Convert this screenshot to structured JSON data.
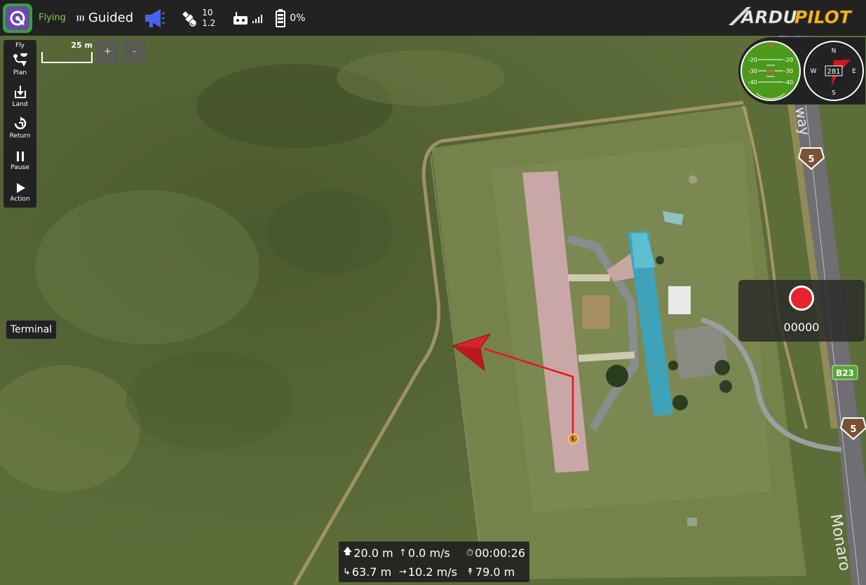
{
  "toolbar": {
    "flight_status": "Flying",
    "flight_mode": "Guided",
    "gps_satellites": "10",
    "gps_hdop": "1.2",
    "battery_percent": "0%",
    "brand_logo": "ARDUPILOT"
  },
  "fly_tools": {
    "title": "Fly",
    "items": [
      {
        "label": "Plan",
        "icon": "plan-icon"
      },
      {
        "label": "Land",
        "icon": "land-icon"
      },
      {
        "label": "Return",
        "icon": "return-icon"
      },
      {
        "label": "Pause",
        "icon": "pause-icon"
      },
      {
        "label": "Action",
        "icon": "action-icon"
      }
    ]
  },
  "map": {
    "scale_label": "25 m",
    "zoom_in_label": "+",
    "zoom_out_label": "-",
    "road_labels": [
      "5",
      "B23",
      "5"
    ],
    "road_name_fragment": "Monaro",
    "road_name_fragment2": "way",
    "home_marker_label": "L"
  },
  "terminal": {
    "label": "Terminal"
  },
  "instruments": {
    "pitch_labels": [
      "-20",
      "-20",
      "-30",
      "-30",
      "-40",
      "-40"
    ],
    "compass": {
      "heading": "281",
      "north": "N",
      "south": "S",
      "east": "E",
      "west": "W"
    }
  },
  "video": {
    "record_time": "00000"
  },
  "telemetry": {
    "altitude": "20.0 m",
    "vertical_speed": "0.0 m/s",
    "flight_time": "00:00:26",
    "distance_home": "63.7 m",
    "ground_speed": "10.2 m/s",
    "altitude_amsl": "79.0 m"
  },
  "colors": {
    "toolbar_bg": "#222222",
    "flying_status": "#7ad35f",
    "record_red": "#e8232f",
    "path_red": "#e8141b",
    "attitude_green": "#4c9a1c"
  }
}
